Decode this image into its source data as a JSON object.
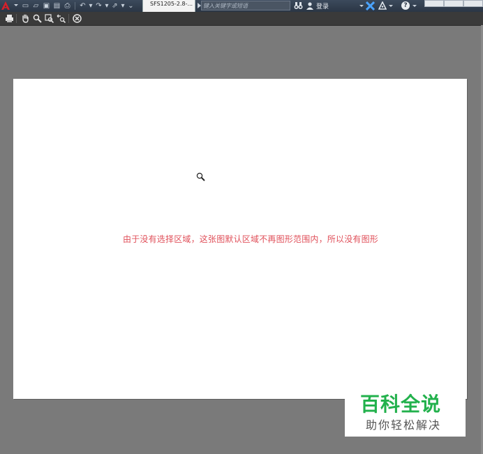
{
  "titlebar": {
    "doc_tab_label": "SFS1205-2.8-...",
    "search_placeholder": "键入关键字或短语",
    "login_label": "登录",
    "help_label": "?"
  },
  "icons": {
    "app_menu": "autocad-a-icon",
    "quick_access": [
      "new-icon",
      "open-icon",
      "save-icon",
      "saveas-icon",
      "plot-icon",
      "undo-icon",
      "redo-icon",
      "share-icon",
      "dropdown-icon"
    ],
    "toolbar": [
      "print-icon",
      "pan-icon",
      "zoom-icon",
      "zoom-window-icon",
      "zoom-original-icon",
      "close-preview-icon"
    ]
  },
  "preview": {
    "message": "由于没有选择区域，这张图默认区域不再图形范围内，所以没有图形"
  },
  "watermark": {
    "title": "百科全说",
    "subtitle": "助你轻松解决",
    "title_color": "#22b14c"
  },
  "colors": {
    "message_color": "#e0505a",
    "canvas_bg": "#7a7a7a",
    "titlebar_bg": "#2b3645"
  }
}
